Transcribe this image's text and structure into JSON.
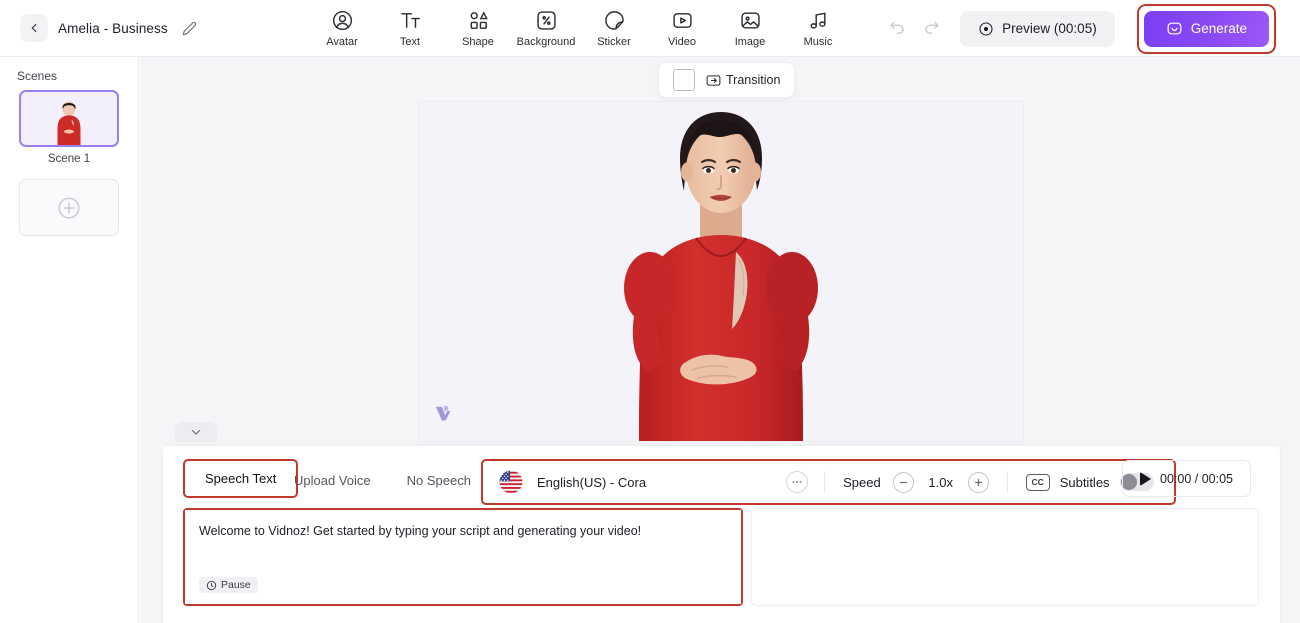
{
  "header": {
    "back_icon": "chevron-left-icon",
    "project_title": "Amelia - Business",
    "edit_icon": "pencil-icon",
    "tools": [
      {
        "label": "Avatar",
        "icon": "avatar-icon"
      },
      {
        "label": "Text",
        "icon": "text-icon"
      },
      {
        "label": "Shape",
        "icon": "shape-icon"
      },
      {
        "label": "Background",
        "icon": "background-icon"
      },
      {
        "label": "Sticker",
        "icon": "sticker-icon"
      },
      {
        "label": "Video",
        "icon": "video-icon"
      },
      {
        "label": "Image",
        "icon": "image-icon"
      },
      {
        "label": "Music",
        "icon": "music-icon"
      }
    ],
    "undo_icon": "undo-icon",
    "redo_icon": "redo-icon",
    "preview_label": "Preview (00:05)",
    "preview_icon": "play-circle-icon",
    "generate_label": "Generate",
    "generate_icon": "sparkle-face-icon",
    "generate_color": "#8b49f5",
    "highlight_color": "#c0392b"
  },
  "sidebar": {
    "title": "Scenes",
    "scenes": [
      {
        "name": "Scene 1",
        "selected": true
      }
    ],
    "add_scene_icon": "plus-circle-icon"
  },
  "canvas": {
    "transition": {
      "thumb_name": "transition-thumbnail",
      "label": "Transition",
      "icon": "transition-icon"
    },
    "stage_background": "#f4f3f9",
    "watermark_icon": "vidnoz-logo-icon",
    "collapse_icon": "chevron-down-icon"
  },
  "bottom": {
    "tabs": [
      {
        "label": "Speech Text",
        "active": true
      },
      {
        "label": "Upload Voice",
        "active": false
      },
      {
        "label": "No Speech",
        "active": false
      }
    ],
    "voice": {
      "flag_icon": "us-flag-icon",
      "name": "English(US) - Cora",
      "more_icon": "ellipsis-icon"
    },
    "speed": {
      "label": "Speed",
      "value": "1.0x",
      "minus_icon": "minus-circle-icon",
      "plus_icon": "plus-circle-icon"
    },
    "subtitles": {
      "cc_label": "CC",
      "label": "Subtitles",
      "enabled": false
    },
    "timeline": {
      "play_icon": "play-icon",
      "time": "00:00 / 00:05"
    },
    "script": {
      "text": "Welcome to Vidnoz! Get started by typing your script and generating your video!",
      "pause_label": "Pause",
      "pause_icon": "clock-icon"
    }
  }
}
